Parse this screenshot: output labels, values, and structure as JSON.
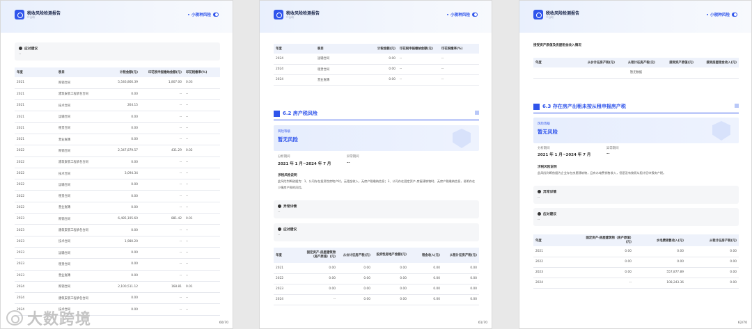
{
  "header": {
    "title": "税收风险检测报告",
    "sub": "**公司",
    "right_label": "小税种风险"
  },
  "page1": {
    "advice_title": "应对建议",
    "advice_value": "--",
    "columns": [
      "年度",
      "税目",
      "计税金额(元)",
      "印花税申报缴纳金额(元)",
      "印花税缴率(%)"
    ],
    "rows": [
      [
        "2021",
        "购销合同",
        "5,546,866.39",
        "1,807.00",
        "0.03"
      ],
      [
        "2021",
        "建筑安装工程承包合同",
        "0.00",
        "--",
        "--"
      ],
      [
        "2021",
        "技术合同",
        "264.15",
        "--",
        "--"
      ],
      [
        "2021",
        "运输合同",
        "0.00",
        "--",
        "--"
      ],
      [
        "2021",
        "租赁合同",
        "0.00",
        "--",
        "--"
      ],
      [
        "2021",
        "营业账簿",
        "0.00",
        "--",
        "--"
      ],
      [
        "2022",
        "购销合同",
        "2,347,879.57",
        "431.29",
        "0.02"
      ],
      [
        "2022",
        "建筑安装工程承包合同",
        "0.00",
        "--",
        "--"
      ],
      [
        "2022",
        "技术合同",
        "3,094.34",
        "--",
        "--"
      ],
      [
        "2022",
        "运输合同",
        "0.00",
        "--",
        "--"
      ],
      [
        "2022",
        "租赁合同",
        "0.00",
        "--",
        "--"
      ],
      [
        "2022",
        "营业账簿",
        "0.00",
        "--",
        "--"
      ],
      [
        "2023",
        "购销合同",
        "6,485,195.60",
        "881.42",
        "0.01"
      ],
      [
        "2023",
        "建筑安装工程承包合同",
        "0.00",
        "--",
        "--"
      ],
      [
        "2023",
        "技术合同",
        "1,980.20",
        "--",
        "--"
      ],
      [
        "2023",
        "运输合同",
        "0.00",
        "--",
        "--"
      ],
      [
        "2023",
        "租赁合同",
        "0.00",
        "--",
        "--"
      ],
      [
        "2023",
        "营业账簿",
        "0.00",
        "--",
        "--"
      ],
      [
        "2024",
        "购销合同",
        "2,100,511.12",
        "168.81",
        "0.01"
      ],
      [
        "2024",
        "建筑安装工程承包合同",
        "0.00",
        "--",
        "--"
      ],
      [
        "2024",
        "技术合同",
        "0.00",
        "--",
        "--"
      ]
    ],
    "page_no": "60/70"
  },
  "page2": {
    "columns": [
      "年度",
      "税目",
      "计税金额(元)",
      "印花税申报缴纳金额(元)",
      "印花税缴率(%)"
    ],
    "rows": [
      [
        "2024",
        "运输合同",
        "0.00",
        "--",
        "--"
      ],
      [
        "2024",
        "租赁合同",
        "0.00",
        "--",
        "--"
      ],
      [
        "2024",
        "营业账簿",
        "0.00",
        "--",
        "--"
      ]
    ],
    "section_title": "6.2 房产税风险",
    "risk_label": "风险等级",
    "risk_value": "暂无风险",
    "period_label": "分析期间",
    "period_value": "2021 年 1 月~2024 年 7 月",
    "anomaly_label": "异常期间",
    "anomaly_value": "--",
    "explain_title": "涉税风险说明",
    "explain_body": "此风险判断依据为：1、公司存在投资性房地产时，无租金收入，无房产税缴纳信息；2、公司存在固定资产-房屋建筑物时，无房产税缴纳信息，说明存在少缴房产税的风险。",
    "detail_title": "异常详情",
    "detail_value": "--",
    "advice_title": "应对建议",
    "advice_value": "--",
    "table2_columns": [
      "年度",
      "固定资产-房屋建筑物（房产原值）(元)",
      "从价计征房产税(元)",
      "投资性房地产金额(元)",
      "租金收入(元)",
      "从租计征房产税(元)"
    ],
    "table2_rows": [
      [
        "2021",
        "0.00",
        "0.00",
        "0.00",
        "0.00",
        "0.00"
      ],
      [
        "2022",
        "0.00",
        "0.00",
        "0.00",
        "0.00",
        "0.00"
      ],
      [
        "2023",
        "0.00",
        "0.00",
        "0.00",
        "0.00",
        "0.00"
      ],
      [
        "2024",
        "--",
        "0.00",
        "0.00",
        "0.00",
        "0.00"
      ]
    ],
    "page_no": "61/70"
  },
  "page3": {
    "table_title": "接受资产原值及房屋租金收入情况",
    "columns": [
      "年度",
      "从价计征房产税(元)",
      "从租计征房产税(元)",
      "接受资产原值(元)",
      "接受房屋租金收入(元)"
    ],
    "empty_text": "暂无数据",
    "section_title": "6.3 存在房产出租未按从租申报房产税",
    "risk_label": "风险等级",
    "risk_value": "暂无风险",
    "period_label": "分析期间",
    "period_value": "2021 年 1 月~2024 年 7 月",
    "anomaly_label": "异常期间",
    "anomaly_value": "--",
    "explain_title": "涉税风险说明",
    "explain_body": "此风险判断依据为企业存在房屋建筑物，且有水电费销售收入，但是没有按照从租计征申报房产税。",
    "detail_title": "异常详情",
    "detail_value": "--",
    "advice_title": "应对建议",
    "advice_value": "--",
    "table2_columns": [
      "年度",
      "固定资产-房屋建筑物（房产原值）(元)",
      "水电费销售收入(元)",
      "从租计征房产税(元)"
    ],
    "table2_rows": [
      [
        "2021",
        "0.00",
        "0.00",
        "0.00"
      ],
      [
        "2022",
        "0.00",
        "0.00",
        "0.00"
      ],
      [
        "2023",
        "0.00",
        "557,877.89",
        "0.00"
      ],
      [
        "2024",
        "--",
        "108,243.36",
        "0.00"
      ]
    ],
    "page_no": "62/70"
  },
  "watermark": "大数跨境"
}
